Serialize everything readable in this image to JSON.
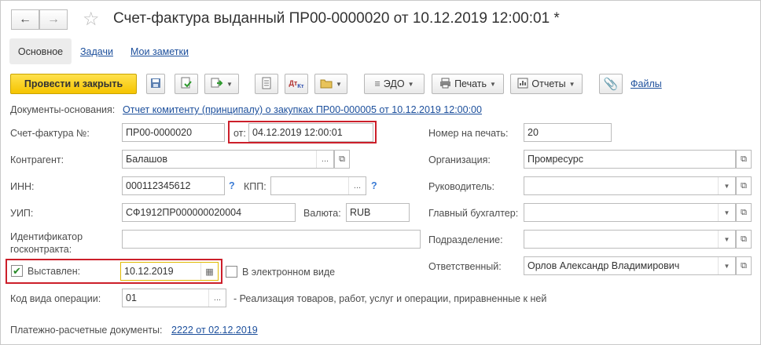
{
  "window": {
    "title": "Счет-фактура выданный ПР00-0000020 от 10.12.2019 12:00:01 *",
    "back_icon": "arrow-left-icon",
    "forward_icon": "arrow-right-icon",
    "favorite_icon": "star-icon"
  },
  "tabs": [
    {
      "label": "Основное",
      "active": true
    },
    {
      "label": "Задачи",
      "active": false
    },
    {
      "label": "Мои заметки",
      "active": false
    }
  ],
  "toolbar": {
    "post_close_label": "Провести и закрыть",
    "edo_label": "ЭДО",
    "print_label": "Печать",
    "reports_label": "Отчеты",
    "files_label": "Файлы",
    "accent_color": "#f5c400"
  },
  "base_docs": {
    "label": "Документы-основания:",
    "link": "Отчет комитенту (принципалу) о закупках ПР00-000005 от 10.12.2019 12:00:00"
  },
  "invoice": {
    "number_label": "Счет-фактура №:",
    "number_value": "ПР00-0000020",
    "date_label": "от:",
    "date_value": "04.12.2019 12:00:01"
  },
  "counterparty": {
    "label": "Контрагент:",
    "value": "Балашов"
  },
  "inn": {
    "label": "ИНН:",
    "value": "000112345612",
    "help": "?"
  },
  "kpp": {
    "label": "КПП:",
    "value": "",
    "help": "?"
  },
  "uip": {
    "label": "УИП:",
    "value": "СФ1912ПР000000020004"
  },
  "currency": {
    "label": "Валюта:",
    "value": "RUB"
  },
  "contract_id": {
    "label_line1": "Идентификатор",
    "label_line2": "госконтракта:",
    "value": ""
  },
  "issued": {
    "label": "Выставлен:",
    "checked": true,
    "date_value": "10.12.2019"
  },
  "electronic": {
    "label": "В электронном виде",
    "checked": false
  },
  "operation": {
    "label": "Код вида операции:",
    "value": "01",
    "description": "- Реализация товаров, работ, услуг и операции, приравненные к ней"
  },
  "payment_docs": {
    "label": "Платежно-расчетные документы:",
    "link": "2222 от 02.12.2019"
  },
  "right": {
    "print_number": {
      "label": "Номер на печать:",
      "value": "20"
    },
    "organization": {
      "label": "Организация:",
      "value": "Промресурс"
    },
    "director": {
      "label": "Руководитель:",
      "value": ""
    },
    "chief_accountant": {
      "label": "Главный бухгалтер:",
      "value": ""
    },
    "department": {
      "label": "Подразделение:",
      "value": ""
    },
    "responsible": {
      "label": "Ответственный:",
      "value": "Орлов Александр Владимирович"
    }
  },
  "highlight_color": "#cc1f2a"
}
